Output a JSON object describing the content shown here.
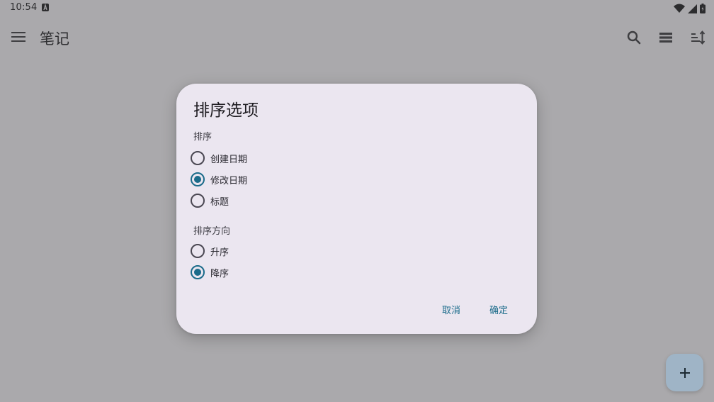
{
  "status_bar": {
    "time": "10:54",
    "icons": [
      "notification-a-icon",
      "wifi-icon",
      "signal-icon",
      "battery-icon"
    ]
  },
  "app_bar": {
    "title": "笔记",
    "icons": [
      "menu-icon",
      "search-icon",
      "view-list-icon",
      "sort-icon"
    ]
  },
  "dialog": {
    "title": "排序选项",
    "sort_label": "排序",
    "sort_options": [
      {
        "label": "创建日期",
        "selected": false
      },
      {
        "label": "修改日期",
        "selected": true
      },
      {
        "label": "标题",
        "selected": false
      }
    ],
    "direction_label": "排序方向",
    "direction_options": [
      {
        "label": "升序",
        "selected": false
      },
      {
        "label": "降序",
        "selected": true
      }
    ],
    "cancel_label": "取消",
    "confirm_label": "确定"
  },
  "fab": {
    "icon": "add-icon"
  },
  "colors": {
    "scrim_background": "#aaa9ac",
    "dialog_background": "#ebe6f0",
    "accent": "#1a6b8a",
    "fab": "#9fb4c6"
  }
}
